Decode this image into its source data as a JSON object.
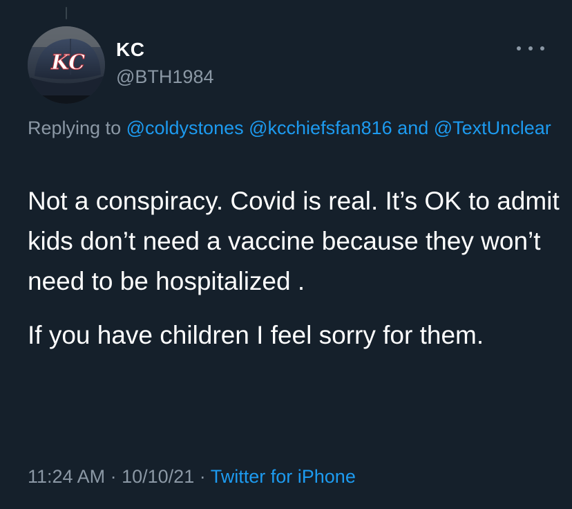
{
  "tweet": {
    "display_name": "KC",
    "handle": "@BTH1984",
    "avatar_logo_text": "KC",
    "replying_prefix": "Replying to",
    "mentions": [
      "@coldystones",
      "@kcchiefsfan816",
      "@TextUnclear"
    ],
    "mention_joiner": "and",
    "body_paragraphs": [
      "Not a conspiracy. Covid is real. It’s OK to admit kids don’t need a vaccine because they won’t need to be hospitalized .",
      "If you have children I feel sorry for them."
    ],
    "time": "11:24 AM",
    "date": "10/10/21",
    "separator": "·",
    "source": "Twitter for iPhone"
  },
  "icons": {
    "more": "more-horizontal-icon",
    "avatar": "kc-cap-avatar"
  },
  "colors": {
    "background": "#15202b",
    "primary_text": "#ffffff",
    "secondary_text": "#8b98a5",
    "link": "#1d9bf0"
  }
}
